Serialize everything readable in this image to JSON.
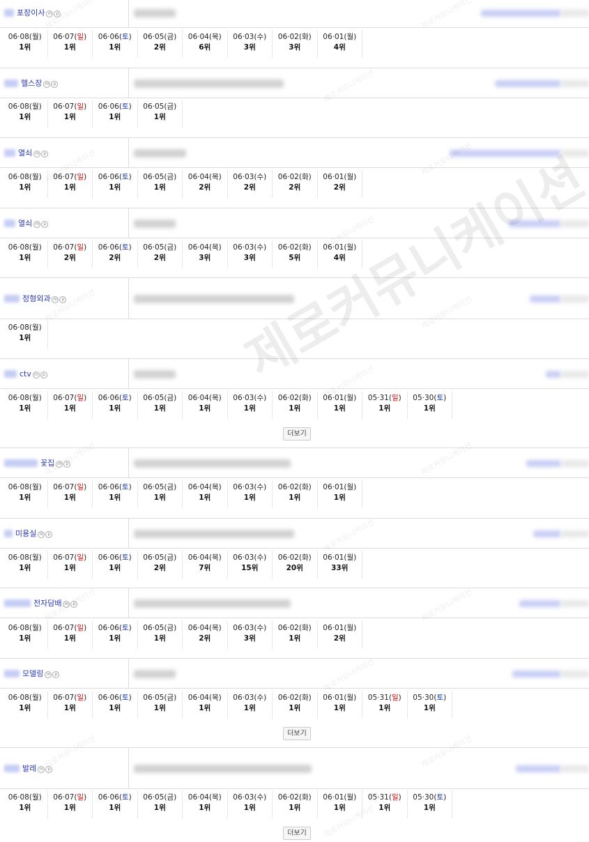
{
  "items": [
    {
      "keyword": "포장이사",
      "ranks": [
        {
          "md": "06·08",
          "dow": "월",
          "rank": "1위"
        },
        {
          "md": "06·07",
          "dow": "일",
          "rank": "1위"
        },
        {
          "md": "06·06",
          "dow": "토",
          "rank": "1위"
        },
        {
          "md": "06·05",
          "dow": "금",
          "rank": "2위"
        },
        {
          "md": "06·04",
          "dow": "목",
          "rank": "6위"
        },
        {
          "md": "06·03",
          "dow": "수",
          "rank": "3위"
        },
        {
          "md": "06·02",
          "dow": "화",
          "rank": "3위"
        },
        {
          "md": "06·01",
          "dow": "월",
          "rank": "4위"
        }
      ],
      "more": ""
    },
    {
      "keyword": "헬스장",
      "ranks": [
        {
          "md": "06·08",
          "dow": "월",
          "rank": "1위"
        },
        {
          "md": "06·07",
          "dow": "일",
          "rank": "1위"
        },
        {
          "md": "06·06",
          "dow": "토",
          "rank": "1위"
        },
        {
          "md": "06·05",
          "dow": "금",
          "rank": "1위"
        }
      ],
      "more": ""
    },
    {
      "keyword": "열쇠",
      "ranks": [
        {
          "md": "06·08",
          "dow": "월",
          "rank": "1위"
        },
        {
          "md": "06·07",
          "dow": "일",
          "rank": "1위"
        },
        {
          "md": "06·06",
          "dow": "토",
          "rank": "1위"
        },
        {
          "md": "06·05",
          "dow": "금",
          "rank": "1위"
        },
        {
          "md": "06·04",
          "dow": "목",
          "rank": "2위"
        },
        {
          "md": "06·03",
          "dow": "수",
          "rank": "2위"
        },
        {
          "md": "06·02",
          "dow": "화",
          "rank": "2위"
        },
        {
          "md": "06·01",
          "dow": "월",
          "rank": "2위"
        }
      ],
      "more": ""
    },
    {
      "keyword": "열쇠",
      "ranks": [
        {
          "md": "06·08",
          "dow": "월",
          "rank": "1위"
        },
        {
          "md": "06·07",
          "dow": "일",
          "rank": "2위"
        },
        {
          "md": "06·06",
          "dow": "토",
          "rank": "2위"
        },
        {
          "md": "06·05",
          "dow": "금",
          "rank": "2위"
        },
        {
          "md": "06·04",
          "dow": "목",
          "rank": "3위"
        },
        {
          "md": "06·03",
          "dow": "수",
          "rank": "3위"
        },
        {
          "md": "06·02",
          "dow": "화",
          "rank": "5위"
        },
        {
          "md": "06·01",
          "dow": "월",
          "rank": "4위"
        }
      ],
      "more": ""
    },
    {
      "keyword": "정형외과",
      "ranks": [
        {
          "md": "06·08",
          "dow": "월",
          "rank": "1위"
        }
      ],
      "more": ""
    },
    {
      "keyword": "ctv",
      "ranks": [
        {
          "md": "06·08",
          "dow": "월",
          "rank": "1위"
        },
        {
          "md": "06·07",
          "dow": "일",
          "rank": "1위"
        },
        {
          "md": "06·06",
          "dow": "토",
          "rank": "1위"
        },
        {
          "md": "06·05",
          "dow": "금",
          "rank": "1위"
        },
        {
          "md": "06·04",
          "dow": "목",
          "rank": "1위"
        },
        {
          "md": "06·03",
          "dow": "수",
          "rank": "1위"
        },
        {
          "md": "06·02",
          "dow": "화",
          "rank": "1위"
        },
        {
          "md": "06·01",
          "dow": "월",
          "rank": "1위"
        },
        {
          "md": "05·31",
          "dow": "일",
          "rank": "1위"
        },
        {
          "md": "05·30",
          "dow": "토",
          "rank": "1위"
        }
      ],
      "more": "더보기"
    },
    {
      "keyword": "꽃집",
      "ranks": [
        {
          "md": "06·08",
          "dow": "월",
          "rank": "1위"
        },
        {
          "md": "06·07",
          "dow": "일",
          "rank": "1위"
        },
        {
          "md": "06·06",
          "dow": "토",
          "rank": "1위"
        },
        {
          "md": "06·05",
          "dow": "금",
          "rank": "1위"
        },
        {
          "md": "06·04",
          "dow": "목",
          "rank": "1위"
        },
        {
          "md": "06·03",
          "dow": "수",
          "rank": "1위"
        },
        {
          "md": "06·02",
          "dow": "화",
          "rank": "1위"
        },
        {
          "md": "06·01",
          "dow": "월",
          "rank": "1위"
        }
      ],
      "more": ""
    },
    {
      "keyword": "미용실",
      "ranks": [
        {
          "md": "06·08",
          "dow": "월",
          "rank": "1위"
        },
        {
          "md": "06·07",
          "dow": "일",
          "rank": "1위"
        },
        {
          "md": "06·06",
          "dow": "토",
          "rank": "1위"
        },
        {
          "md": "06·05",
          "dow": "금",
          "rank": "2위"
        },
        {
          "md": "06·04",
          "dow": "목",
          "rank": "7위"
        },
        {
          "md": "06·03",
          "dow": "수",
          "rank": "15위"
        },
        {
          "md": "06·02",
          "dow": "화",
          "rank": "20위"
        },
        {
          "md": "06·01",
          "dow": "월",
          "rank": "33위"
        }
      ],
      "more": ""
    },
    {
      "keyword": "전자담배",
      "ranks": [
        {
          "md": "06·08",
          "dow": "월",
          "rank": "1위"
        },
        {
          "md": "06·07",
          "dow": "일",
          "rank": "1위"
        },
        {
          "md": "06·06",
          "dow": "토",
          "rank": "1위"
        },
        {
          "md": "06·05",
          "dow": "금",
          "rank": "1위"
        },
        {
          "md": "06·04",
          "dow": "목",
          "rank": "2위"
        },
        {
          "md": "06·03",
          "dow": "수",
          "rank": "3위"
        },
        {
          "md": "06·02",
          "dow": "화",
          "rank": "1위"
        },
        {
          "md": "06·01",
          "dow": "월",
          "rank": "2위"
        }
      ],
      "more": ""
    },
    {
      "keyword": "모델링",
      "ranks": [
        {
          "md": "06·08",
          "dow": "월",
          "rank": "1위"
        },
        {
          "md": "06·07",
          "dow": "일",
          "rank": "1위"
        },
        {
          "md": "06·06",
          "dow": "토",
          "rank": "1위"
        },
        {
          "md": "06·05",
          "dow": "금",
          "rank": "1위"
        },
        {
          "md": "06·04",
          "dow": "목",
          "rank": "1위"
        },
        {
          "md": "06·03",
          "dow": "수",
          "rank": "1위"
        },
        {
          "md": "06·02",
          "dow": "화",
          "rank": "1위"
        },
        {
          "md": "06·01",
          "dow": "월",
          "rank": "1위"
        },
        {
          "md": "05·31",
          "dow": "일",
          "rank": "1위"
        },
        {
          "md": "05·30",
          "dow": "토",
          "rank": "1위"
        }
      ],
      "more": "더보기"
    },
    {
      "keyword": "발레",
      "ranks": [
        {
          "md": "06·08",
          "dow": "월",
          "rank": "1위"
        },
        {
          "md": "06·07",
          "dow": "일",
          "rank": "1위"
        },
        {
          "md": "06·06",
          "dow": "토",
          "rank": "1위"
        },
        {
          "md": "06·05",
          "dow": "금",
          "rank": "1위"
        },
        {
          "md": "06·04",
          "dow": "목",
          "rank": "1위"
        },
        {
          "md": "06·03",
          "dow": "수",
          "rank": "1위"
        },
        {
          "md": "06·02",
          "dow": "화",
          "rank": "1위"
        },
        {
          "md": "06·01",
          "dow": "월",
          "rank": "1위"
        },
        {
          "md": "05·31",
          "dow": "일",
          "rank": "1위"
        },
        {
          "md": "05·30",
          "dow": "토",
          "rank": "1위"
        }
      ],
      "more": "더보기"
    }
  ],
  "icons": {
    "m": "m",
    "p": "p"
  },
  "watermark": {
    "text": "제로커뮤니케이션"
  },
  "colors": {
    "keyword": "#2a39b8",
    "sunday": "#d40000",
    "saturday": "#1533b8"
  }
}
